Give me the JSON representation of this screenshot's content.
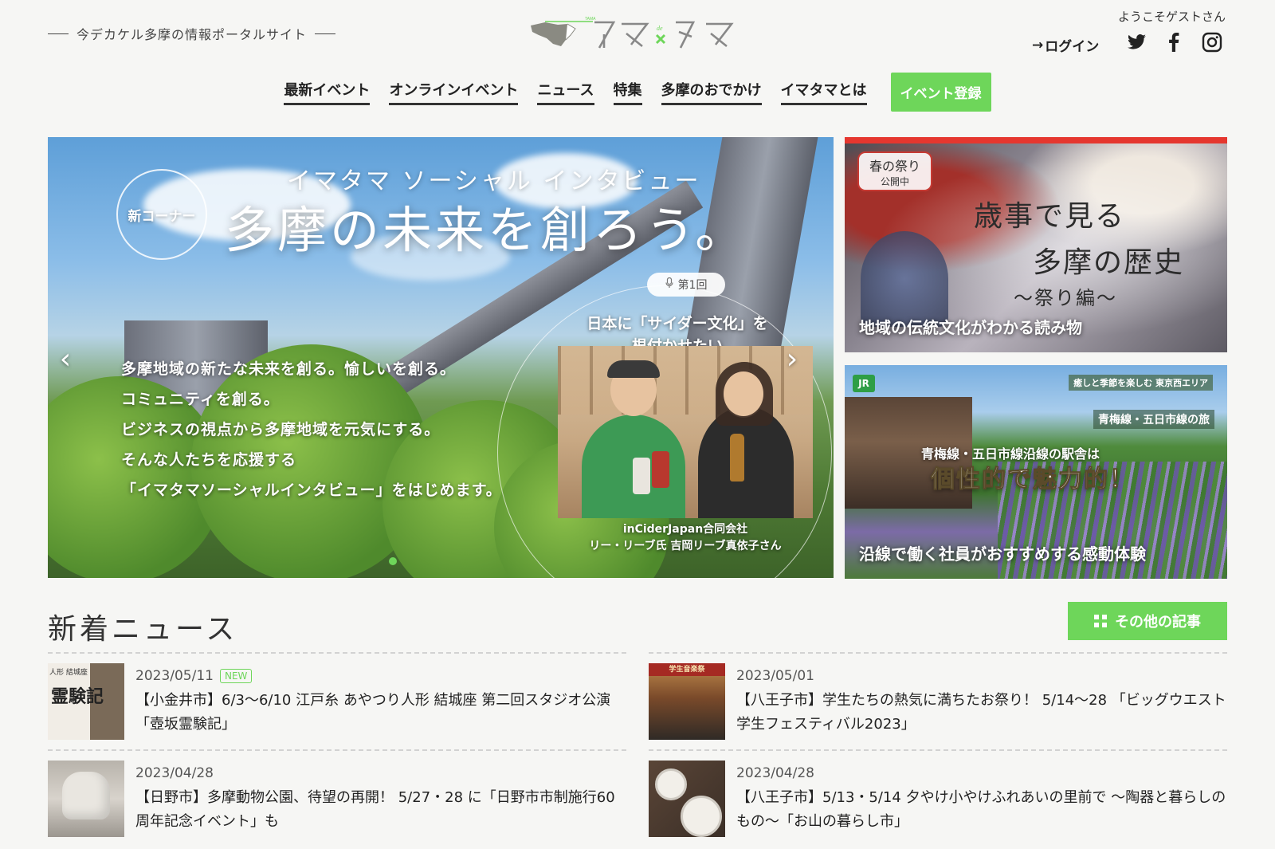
{
  "header": {
    "tagline": "今デカケル多摩の情報ポータルサイト",
    "logo_text": "イマ×タマ",
    "welcome": "ようこそゲストさん",
    "login_label": "ログイン"
  },
  "nav": {
    "items": [
      "最新イベント",
      "オンラインイベント",
      "ニュース",
      "特集",
      "多摩のおでかけ",
      "イマタマとは"
    ],
    "register_label": "イベント登録"
  },
  "hero": {
    "badge": "新コーナー",
    "subtitle": "イマタマ ソーシャル インタビュー",
    "title": "多摩の未来を創ろう。",
    "lines": [
      "多摩地域の新たな未来を創る。愉しいを創る。",
      "コミュニティを創る。",
      "ビジネスの視点から多摩地域を元気にする。",
      "そんな人たちを応援する",
      "「イマタマソーシャルインタビュー」をはじめます。"
    ],
    "episode": "第1回",
    "quote_line1": "日本に「サイダー文化」を",
    "quote_line2": "根付かせたい",
    "company_line1": "inCiderJapan合同会社",
    "company_line2": "リー・リーブ氏 吉岡リーブ真依子さん",
    "prev_icon": "chevron-left-icon",
    "next_icon": "chevron-right-icon"
  },
  "banners": [
    {
      "tag_line1": "春の祭り",
      "tag_line2": "公開中",
      "title_line1": "歳事で見る",
      "title_line2": "多摩の歴史",
      "title_line3": "〜祭り編〜",
      "caption": "地域の伝統文化がわかる読み物"
    },
    {
      "badge": "JR",
      "west_label": "癒しと季節を楽しむ 東京西エリア",
      "route_label": "青梅線・五日市線の旅",
      "line1": "青梅線・五日市線沿線の駅舎は",
      "line2": "個性的で魅力的！",
      "caption": "沿線で働く社員がおすすめする感動体験"
    }
  ],
  "news": {
    "heading": "新着ニュース",
    "more_label": "その他の記事",
    "items": [
      {
        "date": "2023/05/11",
        "new_badge": "NEW",
        "title": "【小金井市】6/3〜6/10 江戸糸 あやつり人形 結城座 第二回スタジオ公演「壺坂霊験記」",
        "thumb_small": "人形 結城座",
        "thumb_big": "霊験記"
      },
      {
        "date": "2023/05/01",
        "title": "【八王子市】学生たちの熱気に満ちたお祭り！ 5/14〜28 「ビッグウエスト学生フェスティバル2023」",
        "thumb_label": "学生音楽祭"
      },
      {
        "date": "2023/04/28",
        "title": "【日野市】多摩動物公園、待望の再開！ 5/27・28 に「日野市市制施行60周年記念イベント」も"
      },
      {
        "date": "2023/04/28",
        "title": "【八王子市】5/13・5/14 夕やけ小やけふれあいの里前で 〜陶器と暮らしのもの〜「お山の暮らし市」"
      }
    ]
  },
  "colors": {
    "accent_green": "#6ed65a",
    "banner_red": "#e5372f"
  }
}
